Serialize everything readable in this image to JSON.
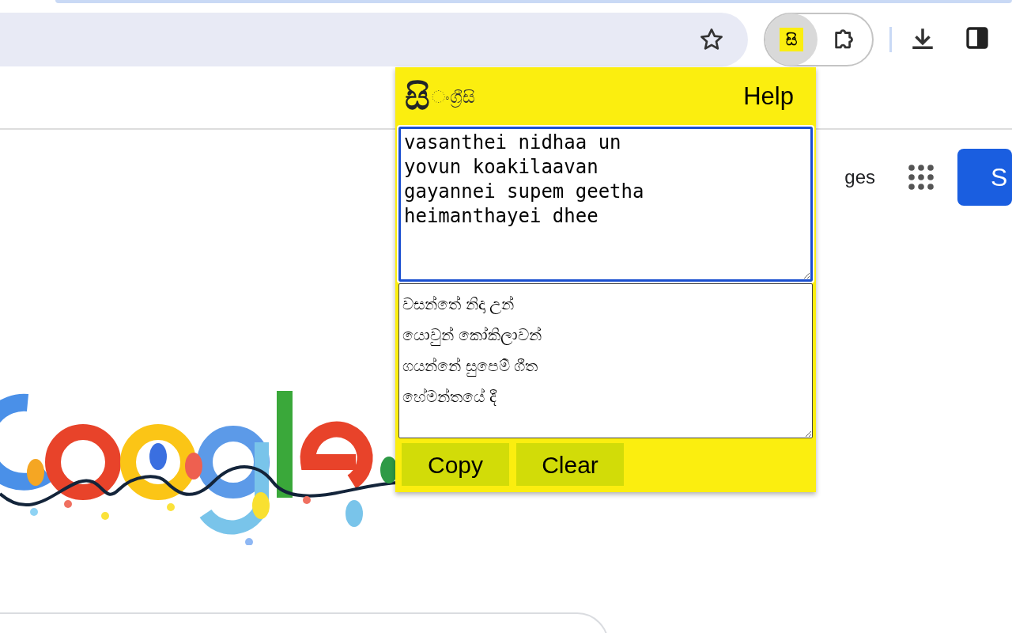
{
  "browser_toolbar": {
    "extension_icon_label": "සි"
  },
  "page": {
    "nav_link": "ges",
    "sign_in_button": "S"
  },
  "popup": {
    "logo_mark": "සි",
    "logo_text": "ංග්‍රීසි",
    "help_link": "Help",
    "input": {
      "value": "vasanthei nidhaa un\nyovun koakilaavan\ngayannei supem geetha\nheimanthayei dhee",
      "focused": true
    },
    "output": {
      "value": "වසන්තේ නිදා උන්\nයොවුන් කෝකිලාවන්\nගයන්නේ සුපෙම් ගීත\nහේමන්තයේ දී"
    },
    "buttons": [
      "Copy",
      "Clear"
    ]
  }
}
